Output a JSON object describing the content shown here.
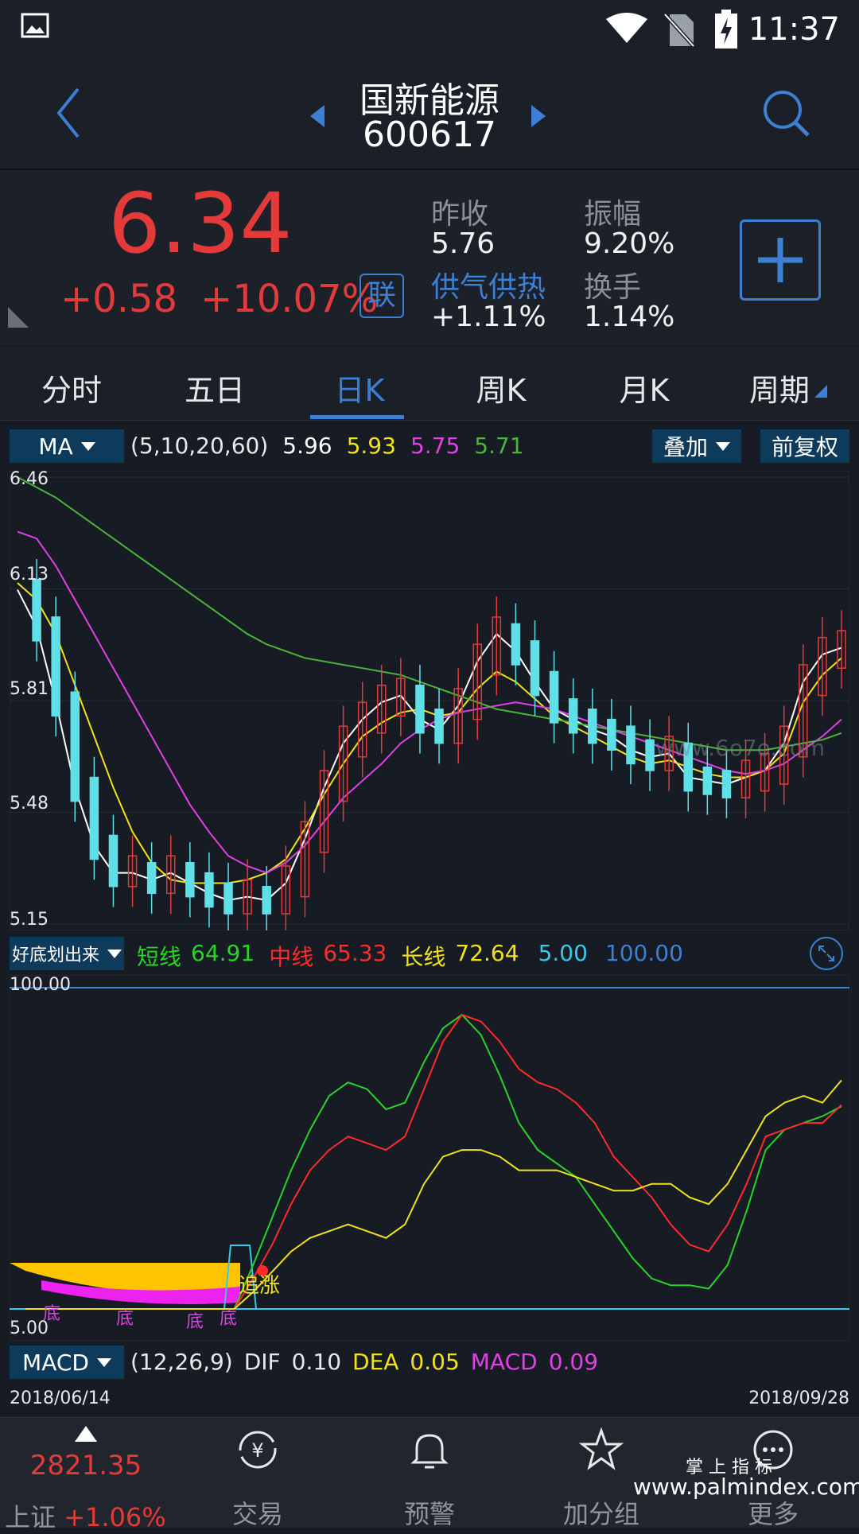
{
  "status": {
    "time": "11:37"
  },
  "header": {
    "name": "国新能源",
    "code": "600617"
  },
  "quote": {
    "price": "6.34",
    "change": "+0.58",
    "change_pct": "+10.07%",
    "lian_badge": "联",
    "prev_close_label": "昨收",
    "prev_close": "5.76",
    "amplitude_label": "振幅",
    "amplitude": "9.20%",
    "sector_label": "供气供热",
    "sector_pct": "+1.11%",
    "turnover_label": "换手",
    "turnover": "1.14%"
  },
  "tabs": [
    "分时",
    "五日",
    "日K",
    "周K",
    "月K",
    "周期"
  ],
  "active_tab": 2,
  "ma": {
    "selector": "MA",
    "params": "(5,10,20,60)",
    "v5": "5.96",
    "v10": "5.93",
    "v20": "5.75",
    "v60": "5.71",
    "overlay": "叠加",
    "adjust": "前复权",
    "colors": {
      "ma5": "#ffffff",
      "ma10": "#f2e21a",
      "ma20": "#e040e6",
      "ma60": "#49b53a"
    }
  },
  "price_axis": [
    "6.46",
    "6.13",
    "5.81",
    "5.48",
    "5.15"
  ],
  "indicator": {
    "selector": "好底划出来",
    "short_label": "短线",
    "short_val": "64.91",
    "mid_label": "中线",
    "mid_val": "65.33",
    "long_label": "长线",
    "long_val": "72.64",
    "v1": "5.00",
    "v2": "100.00",
    "axis_top": "100.00",
    "axis_bottom": "5.00",
    "markers": [
      "底",
      "底",
      "底",
      "底",
      "追涨"
    ]
  },
  "macd": {
    "selector": "MACD",
    "params": "(12,26,9)",
    "dif_label": "DIF",
    "dif": "0.10",
    "dea_label": "DEA",
    "dea": "0.05",
    "macd_label": "MACD",
    "macd_val": "0.09"
  },
  "dates": {
    "start": "2018/06/14",
    "end": "2018/09/28"
  },
  "watermark": "www.6o7o.com",
  "nav": {
    "index_value": "2821.35",
    "index_name": "上证",
    "index_pct": "+1.06%",
    "items": [
      "交易",
      "预警",
      "加分组",
      "更多"
    ]
  },
  "footer_watermark": {
    "line1": "掌 上 指 标",
    "line2": "www.palmindex.com"
  },
  "chart_data": [
    {
      "type": "candlestick",
      "title": "",
      "ylim": [
        5.15,
        6.46
      ],
      "series": [
        {
          "name": "MA5",
          "values": [
            6.13,
            6.02,
            5.8,
            5.55,
            5.38,
            5.3,
            5.3,
            5.28,
            5.3,
            5.27,
            5.24,
            5.22,
            5.23,
            5.22,
            5.27,
            5.4,
            5.55,
            5.68,
            5.75,
            5.8,
            5.82,
            5.75,
            5.72,
            5.79,
            5.92,
            6.0,
            5.95,
            5.86,
            5.78,
            5.75,
            5.72,
            5.7,
            5.66,
            5.64,
            5.65,
            5.58,
            5.57,
            5.56,
            5.58,
            5.6,
            5.68,
            5.86,
            5.94,
            5.96
          ]
        },
        {
          "name": "MA10",
          "values": [
            6.15,
            6.1,
            6.0,
            5.85,
            5.7,
            5.55,
            5.42,
            5.33,
            5.28,
            5.27,
            5.27,
            5.27,
            5.28,
            5.3,
            5.34,
            5.43,
            5.53,
            5.62,
            5.7,
            5.74,
            5.77,
            5.78,
            5.76,
            5.77,
            5.84,
            5.89,
            5.86,
            5.81,
            5.76,
            5.73,
            5.7,
            5.67,
            5.64,
            5.62,
            5.63,
            5.61,
            5.59,
            5.58,
            5.58,
            5.6,
            5.65,
            5.8,
            5.88,
            5.93
          ]
        },
        {
          "name": "MA20",
          "values": [
            6.3,
            6.28,
            6.2,
            6.1,
            6.0,
            5.9,
            5.8,
            5.7,
            5.6,
            5.5,
            5.42,
            5.35,
            5.32,
            5.3,
            5.33,
            5.38,
            5.45,
            5.52,
            5.57,
            5.62,
            5.68,
            5.72,
            5.75,
            5.77,
            5.78,
            5.79,
            5.8,
            5.79,
            5.78,
            5.76,
            5.74,
            5.72,
            5.7,
            5.68,
            5.66,
            5.64,
            5.62,
            5.6,
            5.59,
            5.6,
            5.62,
            5.66,
            5.7,
            5.75
          ]
        },
        {
          "name": "MA60",
          "values": [
            6.46,
            6.43,
            6.4,
            6.36,
            6.32,
            6.28,
            6.24,
            6.2,
            6.16,
            6.12,
            6.08,
            6.04,
            6.0,
            5.97,
            5.95,
            5.93,
            5.92,
            5.91,
            5.9,
            5.89,
            5.88,
            5.86,
            5.84,
            5.82,
            5.8,
            5.78,
            5.77,
            5.76,
            5.75,
            5.74,
            5.73,
            5.72,
            5.71,
            5.7,
            5.69,
            5.68,
            5.67,
            5.66,
            5.66,
            5.66,
            5.67,
            5.68,
            5.69,
            5.71
          ]
        }
      ]
    },
    {
      "type": "line",
      "title": "",
      "ylim": [
        5,
        100
      ],
      "series": [
        {
          "name": "短线",
          "values": [
            5,
            5,
            5,
            5,
            5,
            5,
            5,
            5,
            5,
            5,
            5,
            5,
            18,
            32,
            46,
            58,
            68,
            72,
            70,
            64,
            66,
            78,
            88,
            92,
            86,
            74,
            60,
            52,
            48,
            44,
            36,
            28,
            20,
            14,
            12,
            12,
            11,
            18,
            34,
            52,
            58,
            60,
            62,
            64.91
          ]
        },
        {
          "name": "中线",
          "values": [
            5,
            5,
            5,
            5,
            5,
            5,
            5,
            5,
            5,
            5,
            5,
            5,
            14,
            24,
            36,
            46,
            52,
            56,
            54,
            52,
            56,
            70,
            84,
            92,
            90,
            84,
            76,
            72,
            70,
            66,
            60,
            50,
            44,
            38,
            30,
            24,
            22,
            30,
            42,
            56,
            58,
            60,
            60,
            65.33
          ]
        },
        {
          "name": "长线",
          "values": [
            5,
            5,
            5,
            5,
            5,
            5,
            5,
            5,
            5,
            5,
            5,
            5,
            10,
            16,
            22,
            26,
            28,
            30,
            28,
            26,
            30,
            42,
            50,
            52,
            52,
            50,
            46,
            46,
            46,
            44,
            42,
            40,
            40,
            42,
            42,
            38,
            36,
            42,
            52,
            62,
            66,
            68,
            66,
            72.64
          ]
        }
      ]
    }
  ]
}
